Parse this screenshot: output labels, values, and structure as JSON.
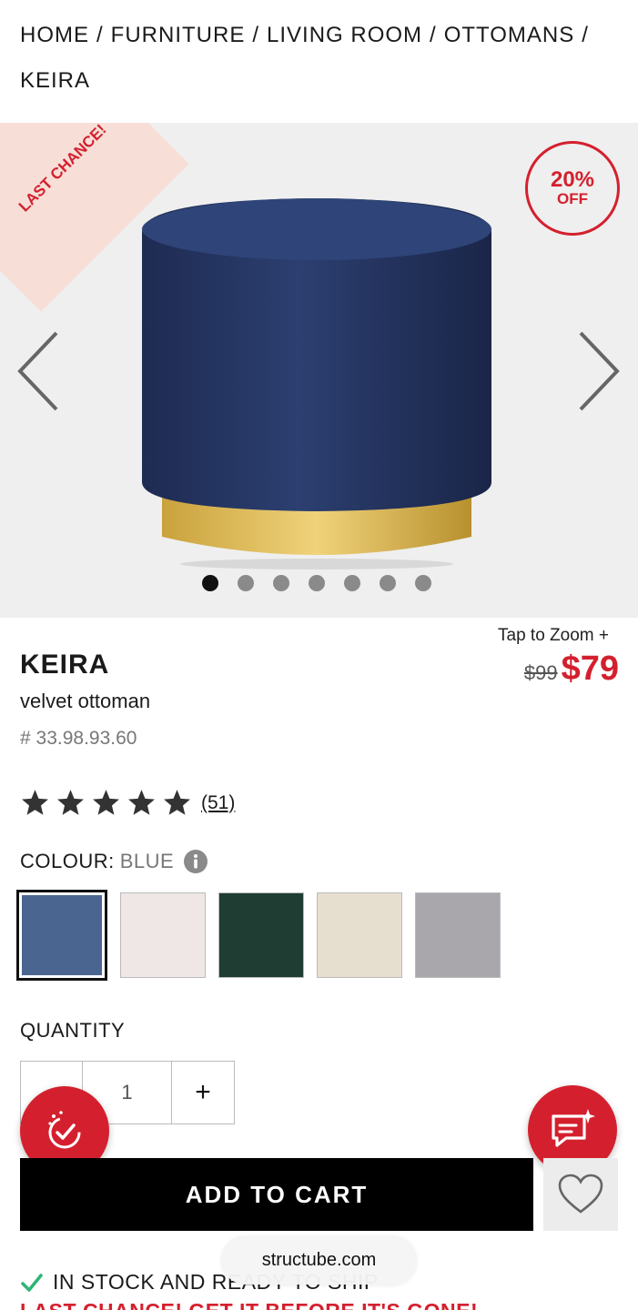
{
  "breadcrumb": {
    "items": [
      "HOME",
      "FURNITURE",
      "LIVING ROOM",
      "OTTOMANS",
      "KEIRA"
    ],
    "separator": "/"
  },
  "gallery": {
    "ribbon_text": "LAST CHANCE!",
    "badge_pct": "20%",
    "badge_off": "OFF",
    "image_count": 7,
    "active_index": 0
  },
  "product": {
    "name": "KEIRA",
    "subtitle": "velvet ottoman",
    "sku": "# 33.98.93.60",
    "tap_zoom": "Tap to Zoom +",
    "old_price": "$99",
    "new_price": "$79",
    "rating_stars": 5,
    "review_count": "(51)"
  },
  "colour": {
    "label": "COLOUR:",
    "value": "BLUE",
    "swatches": [
      {
        "name": "blue",
        "color": "#4a6590",
        "selected": true
      },
      {
        "name": "pink",
        "color": "#efe6e6",
        "selected": false
      },
      {
        "name": "green",
        "color": "#1f3d33",
        "selected": false
      },
      {
        "name": "beige",
        "color": "#e6dfcf",
        "selected": false
      },
      {
        "name": "grey",
        "color": "#a9a7ac",
        "selected": false
      }
    ]
  },
  "quantity": {
    "label": "QUANTITY",
    "minus": "–",
    "value": "1",
    "plus": "+"
  },
  "cart": {
    "add_label": "ADD TO CART"
  },
  "browser": {
    "url": "structube.com"
  },
  "stock": {
    "status": "IN STOCK AND READY TO SHIP",
    "last_chance": "LAST CHANCE! GET IT BEFORE IT'S GONE!"
  },
  "colors": {
    "accent": "#d4202e",
    "success": "#2bb673"
  }
}
